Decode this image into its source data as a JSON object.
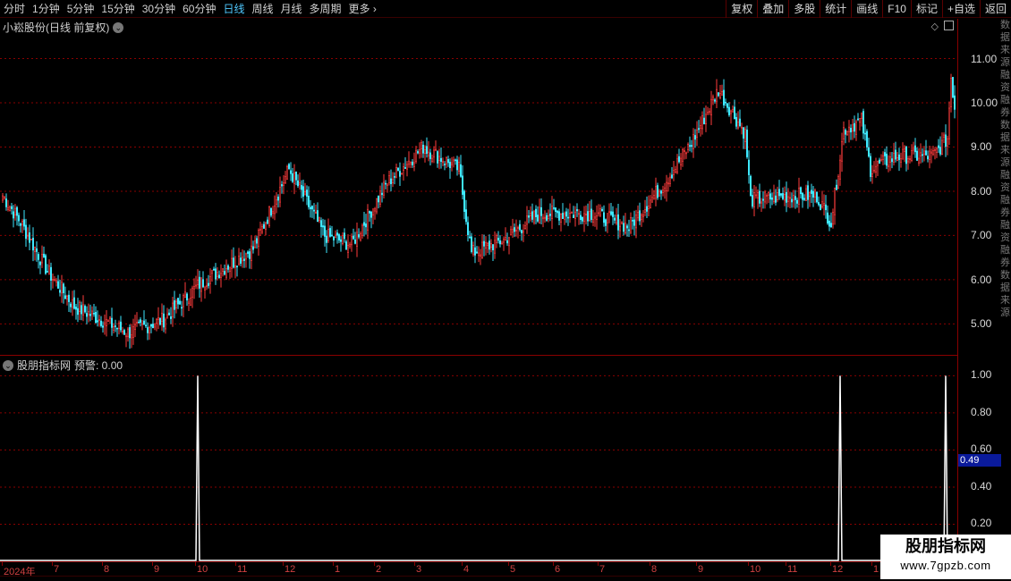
{
  "toolbar": {
    "periods": [
      "分时",
      "1分钟",
      "5分钟",
      "15分钟",
      "30分钟",
      "60分钟",
      "日线",
      "周线",
      "月线",
      "多周期",
      "更多"
    ],
    "active_period": "日线",
    "actions": [
      "复权",
      "叠加",
      "多股",
      "统计",
      "画线",
      "F10",
      "标记",
      "+自选",
      "返回"
    ]
  },
  "main_chart": {
    "title": "小崧股份(日线 前复权)",
    "y_ticks": [
      "11.00",
      "10.00",
      "9.00",
      "8.00",
      "7.00",
      "6.00",
      "5.00"
    ]
  },
  "indicator": {
    "name": "股朋指标网",
    "label": "预警: 0.00",
    "y_ticks": [
      "1.00",
      "0.80",
      "0.60",
      "0.40",
      "0.20"
    ],
    "current_value": "0.49"
  },
  "date_axis": [
    "2024年",
    "7",
    "8",
    "9",
    "10",
    "11",
    "12",
    "1",
    "2",
    "3",
    "4",
    "5",
    "6",
    "7",
    "8",
    "9",
    "10",
    "11",
    "12",
    "1"
  ],
  "watermark": {
    "line1": "股朋指标网",
    "line2": "www.7gpzb.com"
  },
  "right_strip_text": "数据来源融资融券数据来源融资融券融资融券数据来源",
  "colors": {
    "up": "#ff3c3c",
    "down": "#3ee8ff",
    "grid": "#8a0000",
    "signal": "#ffffff"
  },
  "chart_data": {
    "type": "candlestick",
    "price_range": [
      4.3,
      11.9
    ],
    "indicator_range": [
      0,
      1.05
    ],
    "key_points": [
      {
        "x": 0,
        "close": 7.9
      },
      {
        "x": 10,
        "close": 7.3
      },
      {
        "x": 25,
        "close": 6.2
      },
      {
        "x": 40,
        "close": 5.4
      },
      {
        "x": 70,
        "close": 4.8
      },
      {
        "x": 90,
        "close": 5.1
      },
      {
        "x": 110,
        "close": 5.9
      },
      {
        "x": 140,
        "close": 6.7
      },
      {
        "x": 160,
        "close": 8.5
      },
      {
        "x": 180,
        "close": 7.0
      },
      {
        "x": 195,
        "close": 6.8
      },
      {
        "x": 215,
        "close": 8.2
      },
      {
        "x": 235,
        "close": 9.0
      },
      {
        "x": 255,
        "close": 8.5
      },
      {
        "x": 262,
        "close": 6.6
      },
      {
        "x": 280,
        "close": 6.9
      },
      {
        "x": 300,
        "close": 7.5
      },
      {
        "x": 330,
        "close": 7.5
      },
      {
        "x": 350,
        "close": 7.2
      },
      {
        "x": 370,
        "close": 8.2
      },
      {
        "x": 385,
        "close": 9.1
      },
      {
        "x": 400,
        "close": 10.3
      },
      {
        "x": 415,
        "close": 9.3
      },
      {
        "x": 418,
        "close": 7.8
      },
      {
        "x": 440,
        "close": 7.9
      },
      {
        "x": 455,
        "close": 7.9
      },
      {
        "x": 463,
        "close": 7.3
      },
      {
        "x": 470,
        "close": 9.4
      },
      {
        "x": 480,
        "close": 9.6
      },
      {
        "x": 485,
        "close": 8.5
      },
      {
        "x": 500,
        "close": 8.8
      },
      {
        "x": 520,
        "close": 8.8
      },
      {
        "x": 528,
        "close": 9.2
      },
      {
        "x": 530,
        "close": 10.6
      },
      {
        "x": 532,
        "close": 9.9
      }
    ],
    "signals": [
      {
        "x": 109,
        "value": 1.0
      },
      {
        "x": 468,
        "value": 1.0
      },
      {
        "x": 527,
        "value": 1.0
      }
    ]
  }
}
